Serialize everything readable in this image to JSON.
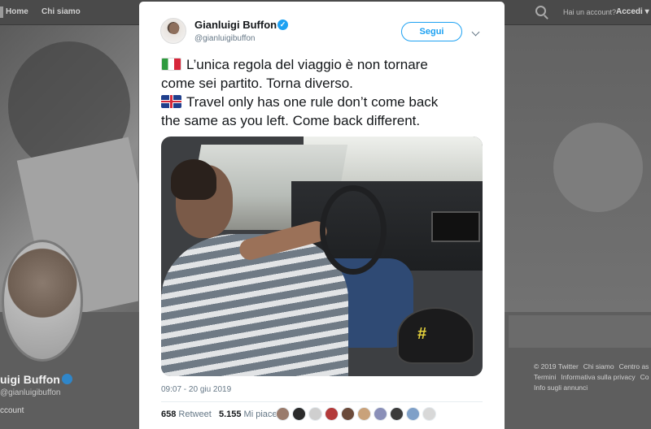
{
  "topnav": {
    "home": "Home",
    "about": "Chi siamo",
    "account_prompt": "Hai un account?",
    "login": "Accedi",
    "login_caret": "▾"
  },
  "background_profile": {
    "name": "uigi Buffon",
    "handle": "@gianluigibuffon",
    "count_label": "ccount",
    "footer_links": [
      "© 2019 Twitter",
      "Chi siamo",
      "Centro as",
      "Termini",
      "Informativa sulla privacy",
      "Co",
      "Info sugli annunci"
    ]
  },
  "tweet": {
    "author_name": "Gianluigi Buffon",
    "author_handle": "@gianluigibuffon",
    "follow_label": "Segui",
    "text_it_1": "L’unica regola del viaggio è non tornare",
    "text_it_2": "come sei partito. Torna diverso.",
    "text_en_1": "Travel only has one rule don’t come back",
    "text_en_2": "the same as you left. Come back different.",
    "timestamp": "09:07 - 20 giu 2019",
    "retweet_count": "658",
    "retweet_label": "Retweet",
    "like_count": "5.155",
    "like_label": "Mi piace",
    "icons": {
      "verified": "verified-badge-icon",
      "more": "chevron-down-icon",
      "flag_it": "italy-flag-icon",
      "flag_uk": "uk-flag-icon"
    },
    "liker_colors": [
      "#9a7b6c",
      "#2b2b2b",
      "#cfcfcf",
      "#b33a3a",
      "#6b4a3a",
      "#c9a27a",
      "#8a8fb8",
      "#3b3b3b",
      "#7fa0c8",
      "#d8d8d8"
    ]
  },
  "colors": {
    "accent": "#1da1f2",
    "text": "#14171a",
    "muted": "#657786"
  }
}
